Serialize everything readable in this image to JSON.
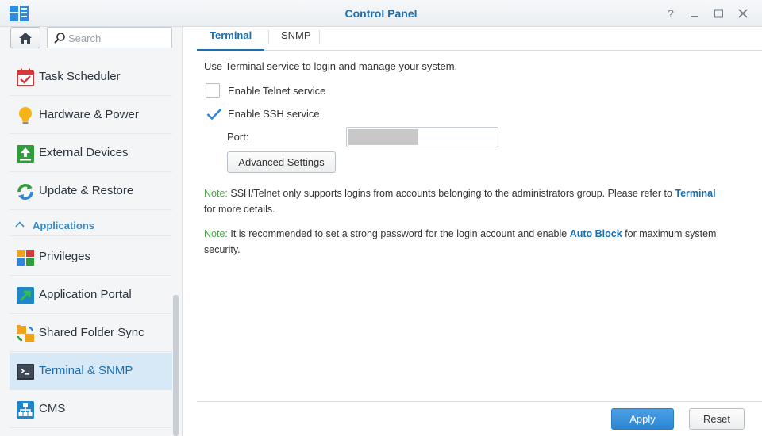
{
  "window": {
    "title": "Control Panel",
    "controls": [
      "help-icon",
      "minimize-icon",
      "maximize-icon",
      "close-icon"
    ]
  },
  "sidebar": {
    "search_placeholder": "Search",
    "items": [
      {
        "label": "Task Scheduler",
        "icon": "task-scheduler-icon"
      },
      {
        "label": "Hardware & Power",
        "icon": "lightbulb-icon"
      },
      {
        "label": "External Devices",
        "icon": "external-devices-icon"
      },
      {
        "label": "Update & Restore",
        "icon": "update-restore-icon"
      }
    ],
    "section": {
      "label": "Applications",
      "expanded": true
    },
    "app_items": [
      {
        "label": "Privileges",
        "icon": "privileges-icon"
      },
      {
        "label": "Application Portal",
        "icon": "application-portal-icon"
      },
      {
        "label": "Shared Folder Sync",
        "icon": "shared-folder-sync-icon"
      },
      {
        "label": "Terminal & SNMP",
        "icon": "terminal-icon",
        "active": true
      },
      {
        "label": "CMS",
        "icon": "cms-icon"
      }
    ]
  },
  "main": {
    "tabs": [
      {
        "label": "Terminal",
        "active": true
      },
      {
        "label": "SNMP",
        "active": false
      }
    ],
    "description": "Use Terminal service to login and manage your system.",
    "telnet": {
      "label": "Enable Telnet service",
      "checked": false
    },
    "ssh": {
      "label": "Enable SSH service",
      "checked": true
    },
    "port": {
      "label": "Port:",
      "value": ""
    },
    "advanced_button": "Advanced Settings",
    "note1": {
      "prefix": "Note:",
      "text_before": " SSH/Telnet only supports logins from accounts belonging to the administrators group. Please refer to ",
      "link": "Terminal",
      "text_after": " for more details."
    },
    "note2": {
      "prefix": "Note:",
      "text_before": " It is recommended to set a strong password for the login account and enable ",
      "link": "Auto Block",
      "text_after": " for maximum system security."
    }
  },
  "footer": {
    "apply": "Apply",
    "reset": "Reset"
  },
  "colors": {
    "accent": "#1a6fb3",
    "note_label": "#4aa34a",
    "active_nav_bg": "#d7e9f7"
  }
}
